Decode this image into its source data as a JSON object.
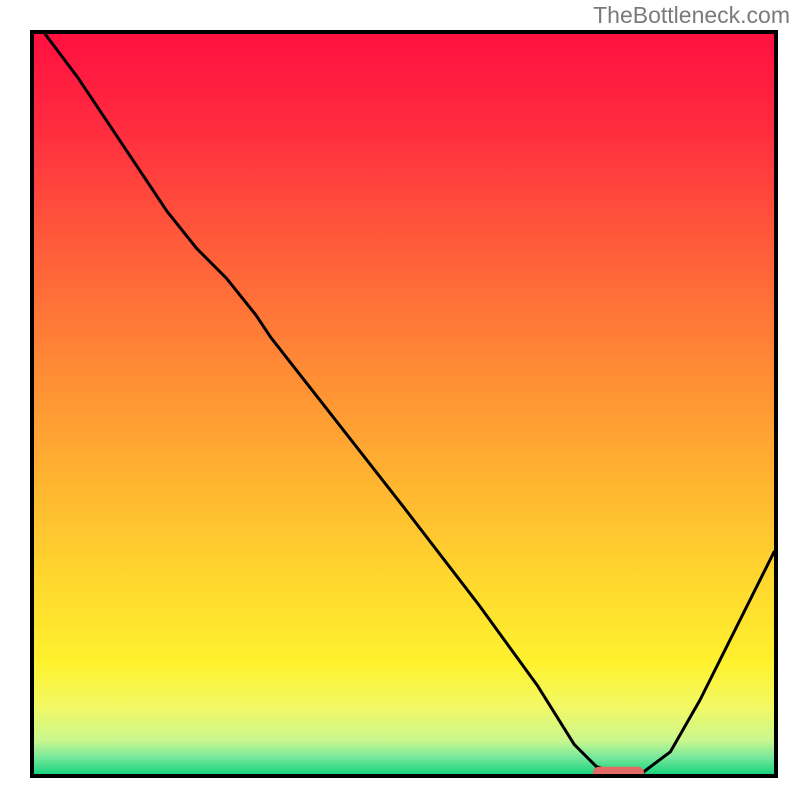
{
  "watermark_text": "TheBottleneck.com",
  "chart_data": {
    "type": "line",
    "title": "",
    "xlabel": "",
    "ylabel": "",
    "xlim": [
      0,
      100
    ],
    "ylim": [
      0,
      100
    ],
    "x": [
      0,
      6,
      10,
      14,
      18,
      22,
      26,
      30,
      32,
      50,
      60,
      68,
      73,
      76,
      79,
      82,
      86,
      90,
      94,
      100
    ],
    "values": [
      102,
      94,
      88,
      82,
      76,
      71,
      67,
      62,
      59,
      36,
      23,
      12,
      4,
      1,
      0,
      0,
      3,
      10,
      18,
      30
    ],
    "gradient_stops": [
      {
        "offset": 0,
        "color": "#ff1040"
      },
      {
        "offset": 0.12,
        "color": "#ff2a3f"
      },
      {
        "offset": 0.28,
        "color": "#ff5a3a"
      },
      {
        "offset": 0.45,
        "color": "#ff8a35"
      },
      {
        "offset": 0.6,
        "color": "#ffb330"
      },
      {
        "offset": 0.74,
        "color": "#ffd82e"
      },
      {
        "offset": 0.85,
        "color": "#fff22e"
      },
      {
        "offset": 0.91,
        "color": "#f2f965"
      },
      {
        "offset": 0.955,
        "color": "#c9f78e"
      },
      {
        "offset": 0.978,
        "color": "#75e89b"
      },
      {
        "offset": 1.0,
        "color": "#19d47e"
      }
    ],
    "marker_x_range": [
      75.5,
      82.5
    ],
    "marker_y": 0,
    "marker_color": "#e46a66",
    "line_color": "#000000",
    "line_width": 3
  }
}
